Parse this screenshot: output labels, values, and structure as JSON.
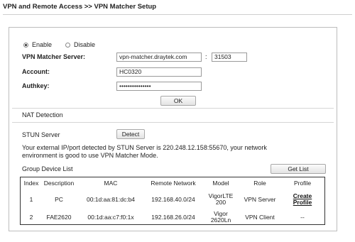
{
  "page": {
    "title": "VPN and Remote Access >> VPN Matcher Setup"
  },
  "form": {
    "enable_label": "Enable",
    "disable_label": "Disable",
    "selected": "Enable",
    "server_label": "VPN Matcher Server:",
    "server_value": "vpn-matcher.draytek.com",
    "port_separator": ":",
    "port_value": "31503",
    "account_label": "Account:",
    "account_value": "HC0320",
    "authkey_label": "Authkey:",
    "authkey_value": "•••••••••••••••",
    "ok_label": "OK"
  },
  "nat": {
    "section_label": "NAT Detection",
    "stun_label": "STUN Server",
    "detect_label": "Detect",
    "result_line1": "Your external IP/port detected by STUN Server is 220.248.12.158:55670, your network",
    "result_line2": "environment is good to use VPN Matcher Mode."
  },
  "group": {
    "label": "Group Device List",
    "get_list_label": "Get List",
    "headers": [
      "Index",
      "Description",
      "MAC",
      "Remote Network",
      "Model",
      "Role",
      "Profile"
    ],
    "rows": [
      {
        "index": "1",
        "description": "PC",
        "mac": "00:1d:aa:81:dc:b4",
        "network": "192.168.40.0/24",
        "model_line1": "VigorLTE",
        "model_line2": "200",
        "role": "VPN Server",
        "profile_line1": "Create",
        "profile_line2": "Profile"
      },
      {
        "index": "2",
        "description": "FAE2620",
        "mac": "00:1d:aa:c7:f0:1x",
        "network": "192.168.26.0/24",
        "model_line1": "Vigor",
        "model_line2": "2620Ln",
        "role": "VPN Client",
        "profile_line1": "--",
        "profile_line2": ""
      }
    ]
  }
}
